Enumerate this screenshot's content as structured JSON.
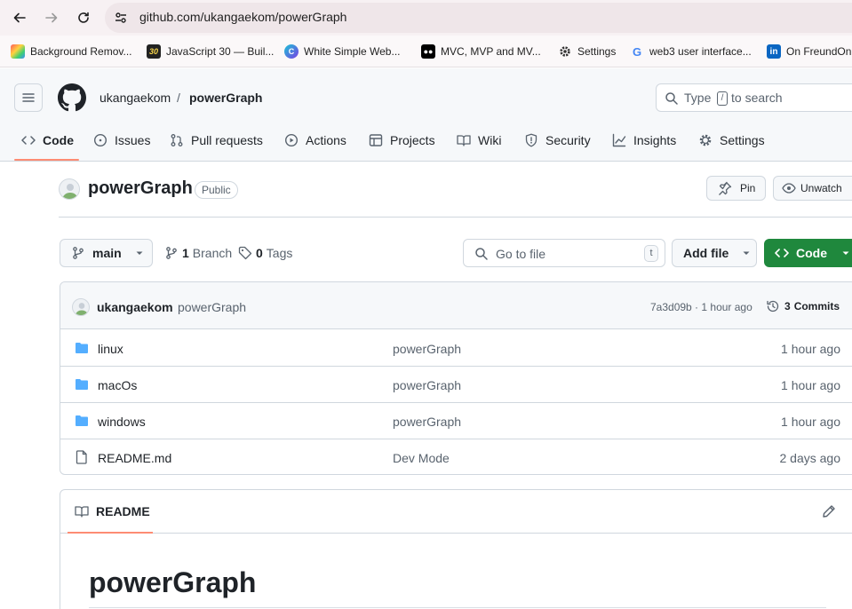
{
  "browser": {
    "url": "github.com/ukangaekom/powerGraph",
    "bookmarks": [
      {
        "label": "Background Remov...",
        "icon": "colorful-square-icon"
      },
      {
        "label": "JavaScript 30 — Buil...",
        "icon": "js30-icon"
      },
      {
        "label": "White Simple Web...",
        "icon": "canva-icon"
      },
      {
        "label": "MVC, MVP and MV...",
        "icon": "medium-icon"
      },
      {
        "label": "Settings",
        "icon": "gear-icon"
      },
      {
        "label": "web3 user interface...",
        "icon": "google-icon"
      },
      {
        "label": "On FreundOn",
        "icon": "linkedin-icon"
      }
    ]
  },
  "header": {
    "owner": "ukangaekom",
    "separator": "/",
    "repo": "powerGraph",
    "search_prefix": "Type",
    "search_key": "/",
    "search_suffix": "to search"
  },
  "tabs": [
    {
      "label": "Code",
      "icon": "code-icon",
      "active": true
    },
    {
      "label": "Issues",
      "icon": "issue-icon"
    },
    {
      "label": "Pull requests",
      "icon": "pull-request-icon"
    },
    {
      "label": "Actions",
      "icon": "play-icon"
    },
    {
      "label": "Projects",
      "icon": "table-icon"
    },
    {
      "label": "Wiki",
      "icon": "book-icon"
    },
    {
      "label": "Security",
      "icon": "shield-icon"
    },
    {
      "label": "Insights",
      "icon": "graph-icon"
    },
    {
      "label": "Settings",
      "icon": "gear-icon"
    }
  ],
  "repo": {
    "name": "powerGraph",
    "visibility": "Public",
    "pin_label": "Pin",
    "unwatch_label": "Unwatch"
  },
  "branchbar": {
    "branch": "main",
    "branch_count": "1",
    "branch_label": "Branch",
    "tag_count": "0",
    "tag_label": "Tags",
    "goto_placeholder": "Go to file",
    "goto_key": "t",
    "add_file": "Add file",
    "code": "Code"
  },
  "commit": {
    "author": "ukangaekom",
    "message": "powerGraph",
    "sha_time": "7a3d09b · 1 hour ago",
    "commits_count": "3",
    "commits_label": "Commits"
  },
  "files": [
    {
      "name": "linux",
      "type": "folder",
      "message": "powerGraph",
      "age": "1 hour ago"
    },
    {
      "name": "macOs",
      "type": "folder",
      "message": "powerGraph",
      "age": "1 hour ago"
    },
    {
      "name": "windows",
      "type": "folder",
      "message": "powerGraph",
      "age": "1 hour ago"
    },
    {
      "name": "README.md",
      "type": "file",
      "message": "Dev Mode",
      "age": "2 days ago"
    }
  ],
  "readme": {
    "tab_label": "README",
    "heading": "powerGraph"
  },
  "colors": {
    "accent_underline": "#fd8c73",
    "code_button": "#1f883d",
    "folder": "#54aeff"
  }
}
